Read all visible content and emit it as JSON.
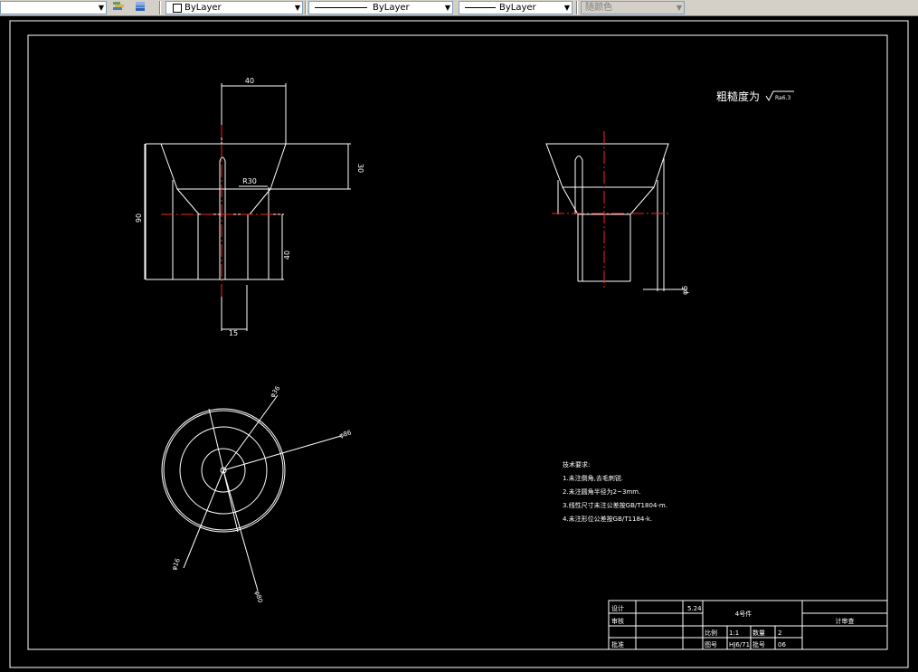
{
  "toolbar": {
    "layer_dropdown_arrow": "▼",
    "color_value": "ByLayer",
    "linetype_value": "ByLayer",
    "lineweight_value": "ByLayer",
    "plotstyle_value": "随颜色"
  },
  "drawing": {
    "roughness_label": "粗糙度为",
    "roughness_value": "Ra6.3",
    "dims": {
      "top_width": "40",
      "right_height": "30",
      "inner_r": "R30",
      "left_height": "90",
      "lower_height": "40",
      "bottom_width": "15",
      "side_phi": "φ5",
      "circle_d1": "φ36",
      "circle_d2": "φ86",
      "circle_d3": "φ16",
      "circle_d4": "φ80"
    },
    "notes": {
      "title": "技术要求:",
      "items": [
        "1.未注倒角,去毛刺锐.",
        "2.未注圆角半径为2~3mm.",
        "3.线性尺寸未注公差按GB/T1804-m.",
        "4.未注形位公差按GB/T1184-k."
      ]
    },
    "title_block": {
      "design_label": "设计",
      "check_label": "审核",
      "approve_label": "批准",
      "date": "5.24",
      "part_name": "4号件",
      "material": "计审查",
      "scale_label": "比例",
      "scale_value": "1:1",
      "qty_label": "数量",
      "qty_value": "2",
      "weight_label": "重量",
      "weight_value": "",
      "drawing_label": "图号",
      "drawing_value": "06",
      "batch_label": "批号",
      "batch_value": "HJ6/71"
    }
  }
}
